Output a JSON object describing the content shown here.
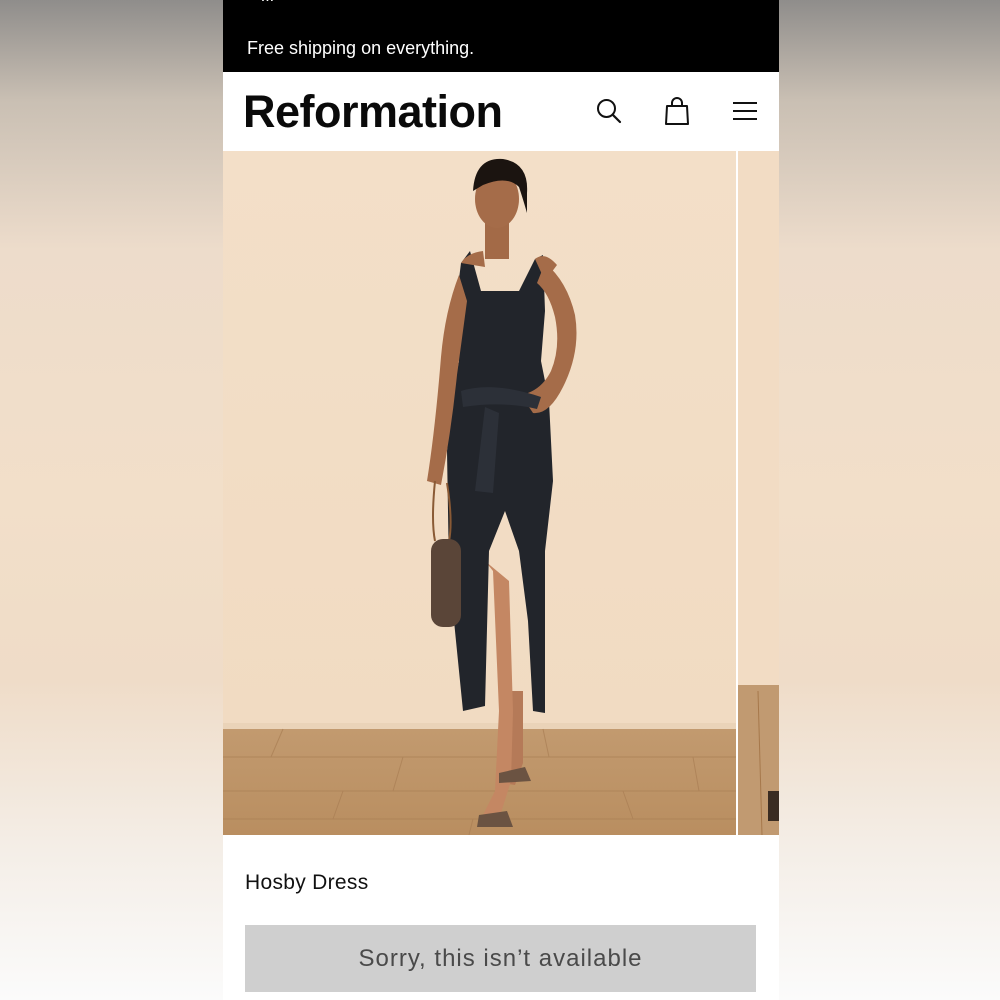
{
  "promo": {
    "partial_text": "+ ...",
    "text": "Free shipping on everything."
  },
  "header": {
    "brand": "Reformation",
    "icons": [
      "search-icon",
      "shopping-bag-icon",
      "hamburger-menu-icon"
    ]
  },
  "gallery": {
    "images": [
      {
        "name": "product-photo-model-black-dress"
      },
      {
        "name": "product-photo-next-partial"
      }
    ]
  },
  "product": {
    "title": "Hosby Dress",
    "availability_button": "Sorry, this isn’t available"
  },
  "colors": {
    "promo_bg": "#000000",
    "button_bg": "#cfcfcf",
    "button_text": "#4a4a4a",
    "dress": "#22252b",
    "backdrop": "#f2dfc9",
    "floor": "#b88d62"
  }
}
